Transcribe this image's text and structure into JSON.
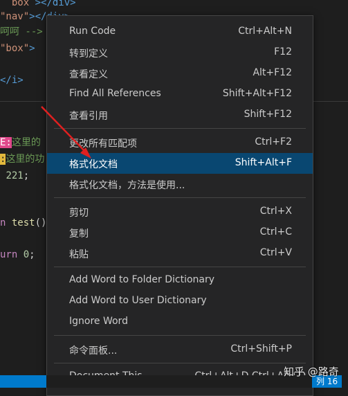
{
  "editor": {
    "line1": {
      "pre": "  box",
      "tag": " ></div>"
    },
    "line2": {
      "str": "\"nav\"",
      "tag": "></div>"
    },
    "line3": {
      "cmt": "呵呵 -->"
    },
    "line4": {
      "str": "\"box\"",
      "tag": ">"
    },
    "line5": {
      "tag": "</i>"
    },
    "line6": {
      "hl": "E:",
      "txt": "这里的"
    },
    "line7": {
      "hl": ":",
      "txt": "这里的功"
    },
    "line8": {
      "num": "221",
      "txt": ";"
    },
    "line9": {
      "kw": "n",
      "fn": "test",
      "txt": "()"
    },
    "line10": {
      "kw": "urn",
      "num": "0",
      "txt": ";"
    }
  },
  "context_menu": {
    "items": [
      {
        "label": "Run Code",
        "shortcut": "Ctrl+Alt+N"
      },
      {
        "label": "转到定义",
        "shortcut": "F12"
      },
      {
        "label": "查看定义",
        "shortcut": "Alt+F12"
      },
      {
        "label": "Find All References",
        "shortcut": "Shift+Alt+F12"
      },
      {
        "label": "查看引用",
        "shortcut": "Shift+F12"
      },
      {
        "label": "更改所有匹配项",
        "shortcut": "Ctrl+F2"
      },
      {
        "label": "格式化文档",
        "shortcut": "Shift+Alt+F"
      },
      {
        "label": "格式化文档，方法是使用...",
        "shortcut": ""
      },
      {
        "label": "剪切",
        "shortcut": "Ctrl+X"
      },
      {
        "label": "复制",
        "shortcut": "Ctrl+C"
      },
      {
        "label": "粘贴",
        "shortcut": "Ctrl+V"
      },
      {
        "label": "Add Word to Folder Dictionary",
        "shortcut": ""
      },
      {
        "label": "Add Word to User Dictionary",
        "shortcut": ""
      },
      {
        "label": "Ignore Word",
        "shortcut": ""
      },
      {
        "label": "命令面板...",
        "shortcut": "Ctrl+Shift+P"
      },
      {
        "label": "Document This",
        "shortcut": "Ctrl+Alt+D Ctrl+Alt+D"
      }
    ],
    "active_label": "格式化文档"
  },
  "status_bar": {
    "column": "列 16"
  },
  "watermark": "知乎 @路奇",
  "colors": {
    "menu_bg": "#252526",
    "active_bg": "#094771",
    "status_bg": "#007acc",
    "arrow": "#e02020"
  }
}
